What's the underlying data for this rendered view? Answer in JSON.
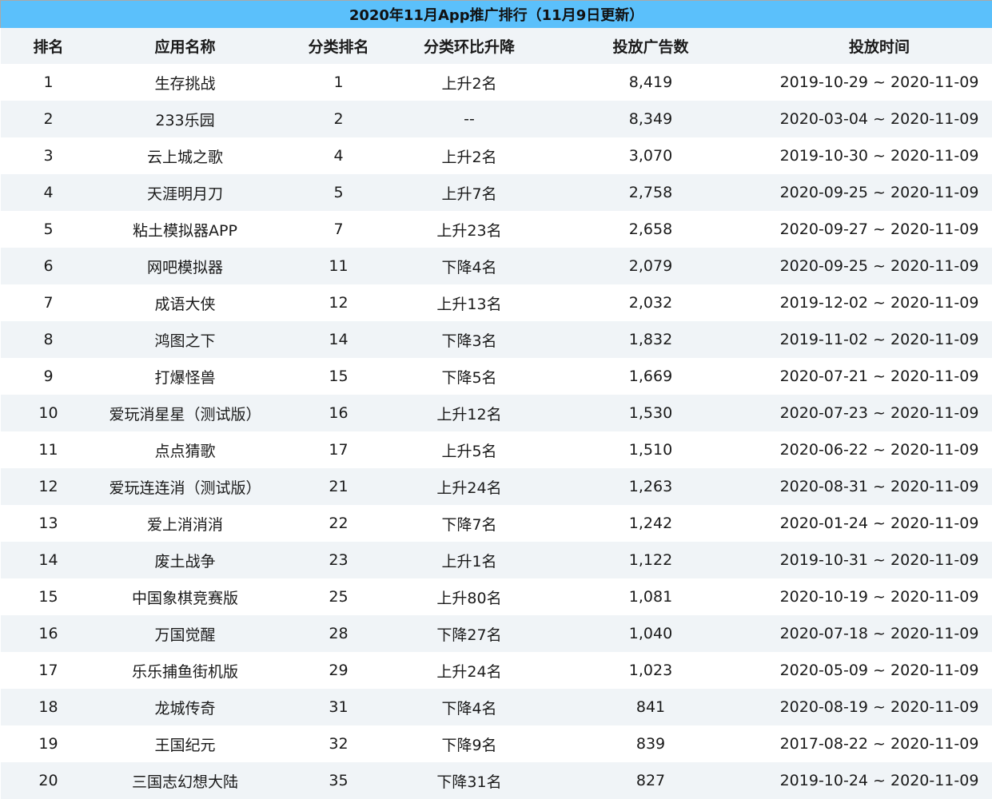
{
  "title": "2020年11月App推广排行（11月9日更新）",
  "columns": [
    "排名",
    "应用名称",
    "分类排名",
    "分类环比升降",
    "投放广告数",
    "投放时间"
  ],
  "rows": [
    [
      "1",
      "生存挑战",
      "1",
      "上升2名",
      "8,419",
      "2019-10-29 ~ 2020-11-09"
    ],
    [
      "2",
      "233乐园",
      "2",
      "--",
      "8,349",
      "2020-03-04 ~ 2020-11-09"
    ],
    [
      "3",
      "云上城之歌",
      "4",
      "上升2名",
      "3,070",
      "2019-10-30 ~ 2020-11-09"
    ],
    [
      "4",
      "天涯明月刀",
      "5",
      "上升7名",
      "2,758",
      "2020-09-25 ~ 2020-11-09"
    ],
    [
      "5",
      "粘土模拟器APP",
      "7",
      "上升23名",
      "2,658",
      "2020-09-27 ~ 2020-11-09"
    ],
    [
      "6",
      "网吧模拟器",
      "11",
      "下降4名",
      "2,079",
      "2020-09-25 ~ 2020-11-09"
    ],
    [
      "7",
      "成语大侠",
      "12",
      "上升13名",
      "2,032",
      "2019-12-02 ~ 2020-11-09"
    ],
    [
      "8",
      "鸿图之下",
      "14",
      "下降3名",
      "1,832",
      "2019-11-02 ~ 2020-11-09"
    ],
    [
      "9",
      "打爆怪兽",
      "15",
      "下降5名",
      "1,669",
      "2020-07-21 ~ 2020-11-09"
    ],
    [
      "10",
      "爱玩消星星（测试版）",
      "16",
      "上升12名",
      "1,530",
      "2020-07-23 ~ 2020-11-09"
    ],
    [
      "11",
      "点点猜歌",
      "17",
      "上升5名",
      "1,510",
      "2020-06-22 ~ 2020-11-09"
    ],
    [
      "12",
      "爱玩连连消（测试版）",
      "21",
      "上升24名",
      "1,263",
      "2020-08-31 ~ 2020-11-09"
    ],
    [
      "13",
      "爱上消消消",
      "22",
      "下降7名",
      "1,242",
      "2020-01-24 ~ 2020-11-09"
    ],
    [
      "14",
      "废土战争",
      "23",
      "上升1名",
      "1,122",
      "2019-10-31 ~ 2020-11-09"
    ],
    [
      "15",
      "中国象棋竞赛版",
      "25",
      "上升80名",
      "1,081",
      "2020-10-19 ~ 2020-11-09"
    ],
    [
      "16",
      "万国觉醒",
      "28",
      "下降27名",
      "1,040",
      "2020-07-18 ~ 2020-11-09"
    ],
    [
      "17",
      "乐乐捕鱼街机版",
      "29",
      "上升24名",
      "1,023",
      "2020-05-09 ~ 2020-11-09"
    ],
    [
      "18",
      "龙城传奇",
      "31",
      "下降4名",
      "841",
      "2020-08-19 ~ 2020-11-09"
    ],
    [
      "19",
      "王国纪元",
      "32",
      "下降9名",
      "839",
      "2017-08-22 ~ 2020-11-09"
    ],
    [
      "20",
      "三国志幻想大陆",
      "35",
      "下降31名",
      "827",
      "2019-10-24 ~ 2020-11-09"
    ]
  ]
}
